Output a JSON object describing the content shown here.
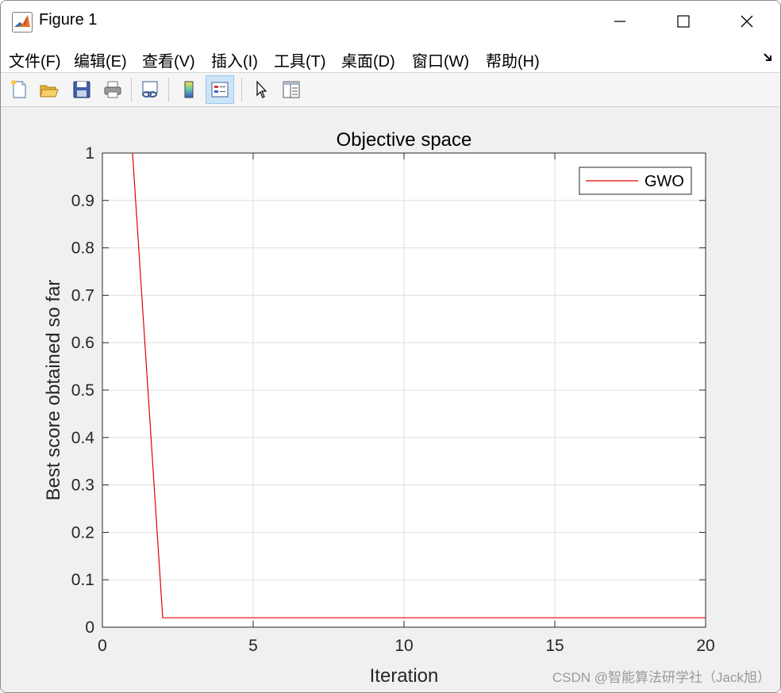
{
  "window": {
    "title": "Figure 1",
    "minimize_glyph": "—",
    "maximize_glyph": "☐",
    "close_glyph": "✕"
  },
  "menu": [
    {
      "label": "文件(F)"
    },
    {
      "label": "编辑(E)"
    },
    {
      "label": "查看(V)"
    },
    {
      "label": "插入(I)"
    },
    {
      "label": "工具(T)"
    },
    {
      "label": "桌面(D)"
    },
    {
      "label": "窗口(W)"
    },
    {
      "label": "帮助(H)"
    }
  ],
  "toolbar": {
    "buttons": [
      {
        "icon": "new-figure-icon"
      },
      {
        "icon": "open-file-icon"
      },
      {
        "icon": "save-icon"
      },
      {
        "icon": "print-icon"
      },
      {
        "icon": "link-plot-icon"
      },
      {
        "icon": "colorbar-icon"
      },
      {
        "icon": "legend-icon",
        "active": true
      },
      {
        "icon": "pointer-icon"
      },
      {
        "icon": "property-inspector-icon"
      }
    ]
  },
  "colors": {
    "series": "#e00000",
    "grid": "#dedede",
    "axes": "#262626",
    "active_button": "#cce4f7"
  },
  "chart_data": {
    "type": "line",
    "title": "Objective space",
    "xlabel": "Iteration",
    "ylabel": "Best score obtained so far",
    "xlim": [
      0,
      20
    ],
    "ylim": [
      0,
      1
    ],
    "xticks": [
      0,
      5,
      10,
      15,
      20
    ],
    "yticks": [
      0,
      0.1,
      0.2,
      0.3,
      0.4,
      0.5,
      0.6,
      0.7,
      0.8,
      0.9,
      1
    ],
    "grid": true,
    "legend_placement": "top-right",
    "series": [
      {
        "name": "GWO",
        "x": [
          1,
          2,
          20
        ],
        "y": [
          1.0,
          0.02,
          0.02
        ]
      }
    ]
  },
  "watermark": "CSDN @智能算法研学社（Jack旭）"
}
